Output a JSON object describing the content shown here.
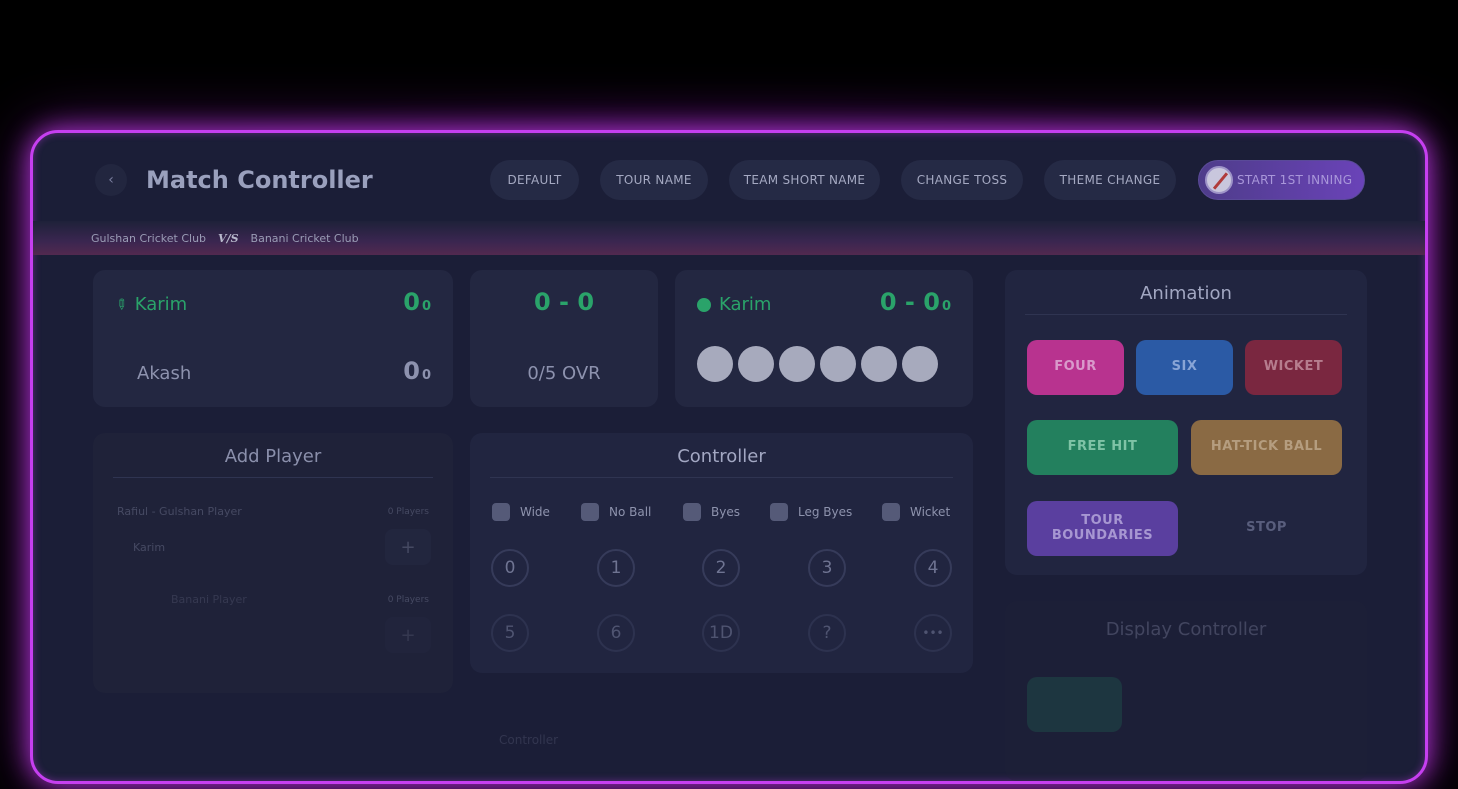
{
  "header": {
    "title": "Match Controller",
    "back_icon": "‹",
    "buttons": [
      "DEFAULT",
      "TOUR NAME",
      "TEAM SHORT NAME",
      "CHANGE TOSS",
      "THEME CHANGE"
    ],
    "start_button": "START 1ST INNING"
  },
  "match": {
    "team_a": "Gulshan Cricket Club",
    "vs": "V/S",
    "team_b": "Banani Cricket Club"
  },
  "batsmen": [
    {
      "name": "Karim",
      "runs": "0",
      "balls": "0"
    },
    {
      "name": "Akash",
      "runs": "0",
      "balls": "0"
    }
  ],
  "score": {
    "total": "0 - 0",
    "overs": "0/5  OVR"
  },
  "bowler": {
    "name": "Karim",
    "figures": "0 - 0",
    "balls": "0"
  },
  "add_player": {
    "title": "Add Player",
    "group1_label": "Rafiul - Gulshan Player",
    "group1_count": "0 Players",
    "group1_input": "Karim",
    "group2_label": "Banani Player",
    "group2_count": "0 Players",
    "add_icon": "+"
  },
  "controller": {
    "title": "Controller",
    "extras": [
      "Wide",
      "No Ball",
      "Byes",
      "Leg Byes",
      "Wicket"
    ],
    "runs_row1": [
      "0",
      "1",
      "2",
      "3",
      "4"
    ],
    "runs_row2": [
      "5",
      "6",
      "1D",
      "?",
      "•••"
    ],
    "footer": "Controller"
  },
  "animation": {
    "title": "Animation",
    "buttons": {
      "four": "FOUR",
      "six": "SIX",
      "wicket": "WICKET",
      "free_hit": "FREE HIT",
      "hat_trick": "HAT-TICK BALL",
      "tour_boundaries": "TOUR BOUNDARIES",
      "stop": "STOP"
    }
  },
  "display_controller": {
    "title": "Display Controller"
  },
  "colors": {
    "accent_glow": "#c63ff0",
    "green": "#2aa36a",
    "four": "#b8338f",
    "six": "#2b5aa5",
    "wicket": "#7a2740",
    "free_hit": "#23805e",
    "hat_trick": "#8a6a44",
    "tour": "#5a3f9f"
  }
}
